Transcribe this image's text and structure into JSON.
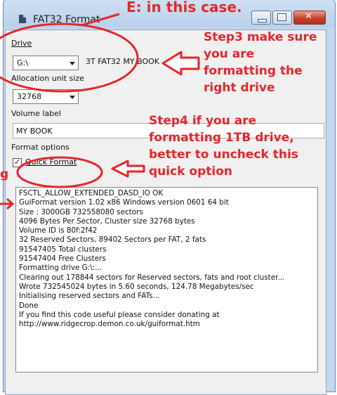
{
  "window": {
    "title": "FAT32 Format",
    "controls": [
      "minimize",
      "maximize",
      "close"
    ]
  },
  "form": {
    "drive_label": "Drive",
    "drive_value": "G:\\",
    "drive_info": "3T FAT32 MY BOOK",
    "allocation_label": "Allocation unit size",
    "allocation_value": "32768",
    "volume_label": "Volume label",
    "volume_value": "MY BOOK",
    "format_options_label": "Format options",
    "quick_format_label": "Quick Format",
    "quick_format_checked": true
  },
  "log_lines": [
    "FSCTL_ALLOW_EXTENDED_DASD_IO OK",
    "GuiFormat version 1.02 x86 Windows version 0601 64 bit",
    "Size : 3000GB 732558080 sectors",
    "4096 Bytes Per Sector, Cluster size 32768 bytes",
    "Volume ID is 80f:2f42",
    "32 Reserved Sectors, 89402 Sectors per FAT, 2 fats",
    "91547405 Total clusters",
    "91547404 Free Clusters",
    "Formatting drive G:\\:...",
    "Clearing out 178844 sectors for Reserved sectors, fats and root cluster...",
    "Wrote 732545024 bytes in 5.60 seconds, 124.78 Megabytes/sec",
    "Initialising reserved sectors and FATs...",
    "Done",
    "If you find this code useful please consider donating at",
    "http://www.ridgecrop.demon.co.uk/guiformat.htm"
  ],
  "annotations": {
    "top": "E: in this case.",
    "step3": [
      "Step3 make sure",
      "you are",
      "formatting the",
      "right drive"
    ],
    "step4": [
      "Step4 if you are",
      "formatting 1TB drive,",
      "better to uncheck this",
      "quick option"
    ],
    "edge_letter": "g"
  },
  "colors": {
    "annotation": "#e6262b",
    "titlebar": "#b9d1ea"
  }
}
